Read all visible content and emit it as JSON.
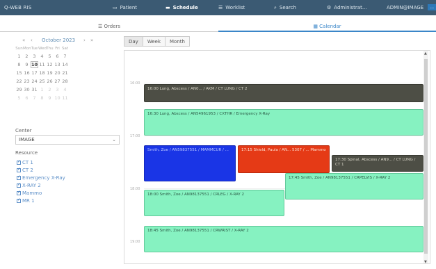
{
  "app": {
    "brand": "Q-WEB RIS"
  },
  "topnav": {
    "items": [
      {
        "label": "Patient",
        "icon": "patient-icon"
      },
      {
        "label": "Schedule",
        "icon": "schedule-icon"
      },
      {
        "label": "Worklist",
        "icon": "worklist-icon"
      },
      {
        "label": "Search",
        "icon": "search-icon"
      },
      {
        "label": "Administrat...",
        "icon": "settings-icon"
      }
    ],
    "user": "ADMIN@IMAGE",
    "user_tag": "..."
  },
  "tabs": [
    {
      "label": "Orders",
      "icon": "list-icon"
    },
    {
      "label": "Calendar",
      "icon": "calendar-icon"
    }
  ],
  "mini_calendar": {
    "month": "October 2023",
    "prev_year": "«",
    "prev_month": "‹",
    "next_month": "›",
    "next_year": "»",
    "dow": [
      "Sun",
      "Mon",
      "Tue",
      "Wed",
      "Thu",
      "Fri",
      "Sat"
    ],
    "weeks": [
      [
        "1",
        "2",
        "3",
        "4",
        "5",
        "6",
        "7"
      ],
      [
        "8",
        "9",
        "10",
        "11",
        "12",
        "13",
        "14"
      ],
      [
        "15",
        "16",
        "17",
        "18",
        "19",
        "20",
        "21"
      ],
      [
        "22",
        "23",
        "24",
        "25",
        "26",
        "27",
        "28"
      ],
      [
        "29",
        "30",
        "31",
        "1",
        "2",
        "3",
        "4"
      ],
      [
        "5",
        "6",
        "7",
        "8",
        "9",
        "10",
        "11"
      ]
    ],
    "selected": "10"
  },
  "filters": {
    "center_label": "Center",
    "center_value": "IMAGE",
    "resource_label": "Resource",
    "resources": [
      "CT 1",
      "CT 2",
      "Emergency X-Ray",
      "X-RAY 2",
      "Mammo",
      "MR 1"
    ]
  },
  "views": {
    "day": "Day",
    "week": "Week",
    "month": "Month"
  },
  "times": {
    "t1": "16:00",
    "t2": "17:00",
    "t3": "18:00",
    "t4": "19:00"
  },
  "events": {
    "e1": "16:00 Lung, Abscess / AN0... / AKM / CT LUNG / CT 2",
    "e2": "16:30 Lung, Abscess / AN54961953 / CXTHR / Emergency X-Ray",
    "e3": "Smith, Zoe / AN59837551 / MAMMCUR / ...",
    "e4": "17:15 Shield, Paula / AN... 5307 / ... Mammo",
    "e5": "17:30 Spinal, Abscess / AN9... / CT LUNG / CT 1",
    "e6": "17:45 Smith, Zoe / AN98137551 / CRPELVIS / X-RAY 2",
    "e7": "18:00 Smith, Zoe / AN98137551 / CRLEG / X-RAY 2",
    "e8": "18:45 Smith, Zoe / AN98137551 / CRWRIST / X-RAY 2"
  }
}
